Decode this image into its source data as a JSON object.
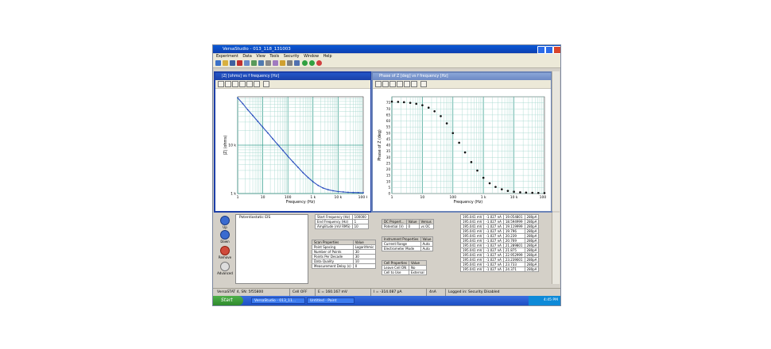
{
  "window": {
    "title": "VersaStudio - 013_118_131003",
    "menu": [
      "Experiment",
      "Data",
      "View",
      "Tools",
      "Security",
      "Window",
      "Help"
    ]
  },
  "pane_left": {
    "title": "|Z| [ohms] vs f frequency [Hz]",
    "chart_data": {
      "type": "line",
      "xlabel": "Frequency (Hz)",
      "ylabel": "|Z| (ohms)",
      "xscale": "log",
      "yscale": "log",
      "xlim": [
        1,
        100000
      ],
      "ylim": [
        1000,
        100000
      ],
      "x_ticks": [
        "1",
        "10",
        "100",
        "1 k",
        "10 k",
        "100 k"
      ],
      "y_ticks": [
        "1 k",
        "10 k"
      ],
      "grid": true,
      "series": [
        {
          "color": "#2b4fbf",
          "x": [
            1,
            1.6,
            2.5,
            4,
            6.3,
            10,
            16,
            25,
            40,
            63,
            100,
            160,
            250,
            400,
            630,
            1000,
            1600,
            2500,
            4000,
            6300,
            10000,
            16000,
            25000,
            40000,
            63000,
            100000
          ],
          "y": [
            95000,
            72000,
            54000,
            41000,
            31000,
            23500,
            17800,
            13500,
            10200,
            7800,
            5900,
            4500,
            3500,
            2700,
            2150,
            1750,
            1470,
            1300,
            1200,
            1140,
            1100,
            1080,
            1060,
            1050,
            1045,
            1040
          ]
        }
      ]
    }
  },
  "pane_right": {
    "title": "Phase of Z [deg] vs f frequency [Hz]",
    "chart_data": {
      "type": "scatter",
      "xlabel": "Frequency (Hz)",
      "ylabel": "Phase of Z (deg)",
      "xscale": "log",
      "xlim": [
        1,
        100000
      ],
      "ylim": [
        0,
        80
      ],
      "x_ticks": [
        "1",
        "10",
        "100",
        "1 k",
        "10 k",
        "100 k"
      ],
      "y_ticks": [
        "75",
        "70",
        "65",
        "60",
        "55",
        "50",
        "45",
        "40",
        "35",
        "30",
        "25",
        "20",
        "15",
        "10",
        "5",
        "0"
      ],
      "grid": true,
      "series": [
        {
          "color": "#111111",
          "x": [
            1,
            1.6,
            2.5,
            4,
            6.3,
            10,
            16,
            25,
            40,
            63,
            100,
            160,
            250,
            400,
            630,
            1000,
            1600,
            2500,
            4000,
            6300,
            10000,
            16000,
            25000,
            40000,
            63000,
            100000
          ],
          "y": [
            76,
            75.8,
            75.5,
            75,
            74.2,
            73,
            71,
            68,
            64,
            58,
            50,
            42,
            34,
            26,
            19,
            13,
            8.5,
            5.5,
            3.5,
            2.2,
            1.5,
            1,
            0.8,
            0.6,
            0.5,
            0.4
          ]
        }
      ]
    }
  },
  "sidebar": {
    "up": "Up",
    "down": "Down",
    "remove": "Remove",
    "advanced": "Advanced"
  },
  "sequence": {
    "item": "Potentiostatic EIS"
  },
  "start_params": [
    [
      "Start Frequency (Hz)",
      "100000"
    ],
    [
      "End Frequency (Hz)",
      "1"
    ],
    [
      "Amplitude (mV RMS)",
      "10"
    ]
  ],
  "dc_table": {
    "headers": [
      "DC Propert...",
      "Value",
      "Versus"
    ],
    "row": [
      "Potential (V)",
      "0",
      "vs OC"
    ]
  },
  "scan_table": {
    "headers": [
      "Scan Properties",
      "Value"
    ],
    "rows": [
      [
        "Point Spacing",
        "Logarithmic"
      ],
      [
        "Number of Points",
        "30"
      ],
      [
        "Points Per Decade",
        "30"
      ],
      [
        "Data Quality",
        "10"
      ],
      [
        "Measurement Delay (s)",
        "0"
      ]
    ]
  },
  "instrument_table": {
    "headers": [
      "Instrument Properties",
      "Value"
    ],
    "rows": [
      [
        "Current Range",
        "Auto"
      ],
      [
        "Electrometer Mode",
        "Auto"
      ]
    ]
  },
  "cell_table": {
    "headers": [
      "Cell Properties",
      "Value"
    ],
    "rows": [
      [
        "Leave Cell ON",
        "No"
      ],
      [
        "Cell to Use",
        "External"
      ]
    ]
  },
  "data_rows": [
    [
      "195.041 mV",
      "-1.027 nA",
      "19.054801",
      "280pA"
    ],
    [
      "195.041 mV",
      "-1.027 nA",
      "18.594999",
      "280pA"
    ],
    [
      "195.041 mV",
      "-1.027 nA",
      "19.119999",
      "280pA"
    ],
    [
      "195.041 mV",
      "-1.027 nA",
      "19.796",
      "280pA"
    ],
    [
      "195.041 mV",
      "-1.027 nA",
      "20.239",
      "280pA"
    ],
    [
      "195.041 mV",
      "-1.027 nA",
      "20.769",
      "280pA"
    ],
    [
      "195.041 mV",
      "-1.027 nA",
      "21.289801",
      "280pA"
    ],
    [
      "195.041 mV",
      "-1.027 nA",
      "21.875",
      "280pA"
    ],
    [
      "195.041 mV",
      "-1.027 nA",
      "22.952999",
      "280pA"
    ],
    [
      "195.041 mV",
      "-1.027 nA",
      "23.239001",
      "280pA"
    ],
    [
      "195.041 mV",
      "-1.027 nA",
      "23.733",
      "280pA"
    ],
    [
      "195.041 mV",
      "-1.027 nA",
      "24.371",
      "280pA"
    ]
  ],
  "status": {
    "instrument": "VersaSTAT 4, SN: 5f55800",
    "cell": "Cell OFF",
    "potential": "E = 160.167 mV",
    "current": "I = -314.087 pA",
    "range": "4nA",
    "security": "Logged in: Security Disabled"
  },
  "taskbar": {
    "start": "Start",
    "tasks": [
      "VersaStudio - 013_11...",
      "Untitled - Paint"
    ],
    "clock": "4:45 PM"
  }
}
